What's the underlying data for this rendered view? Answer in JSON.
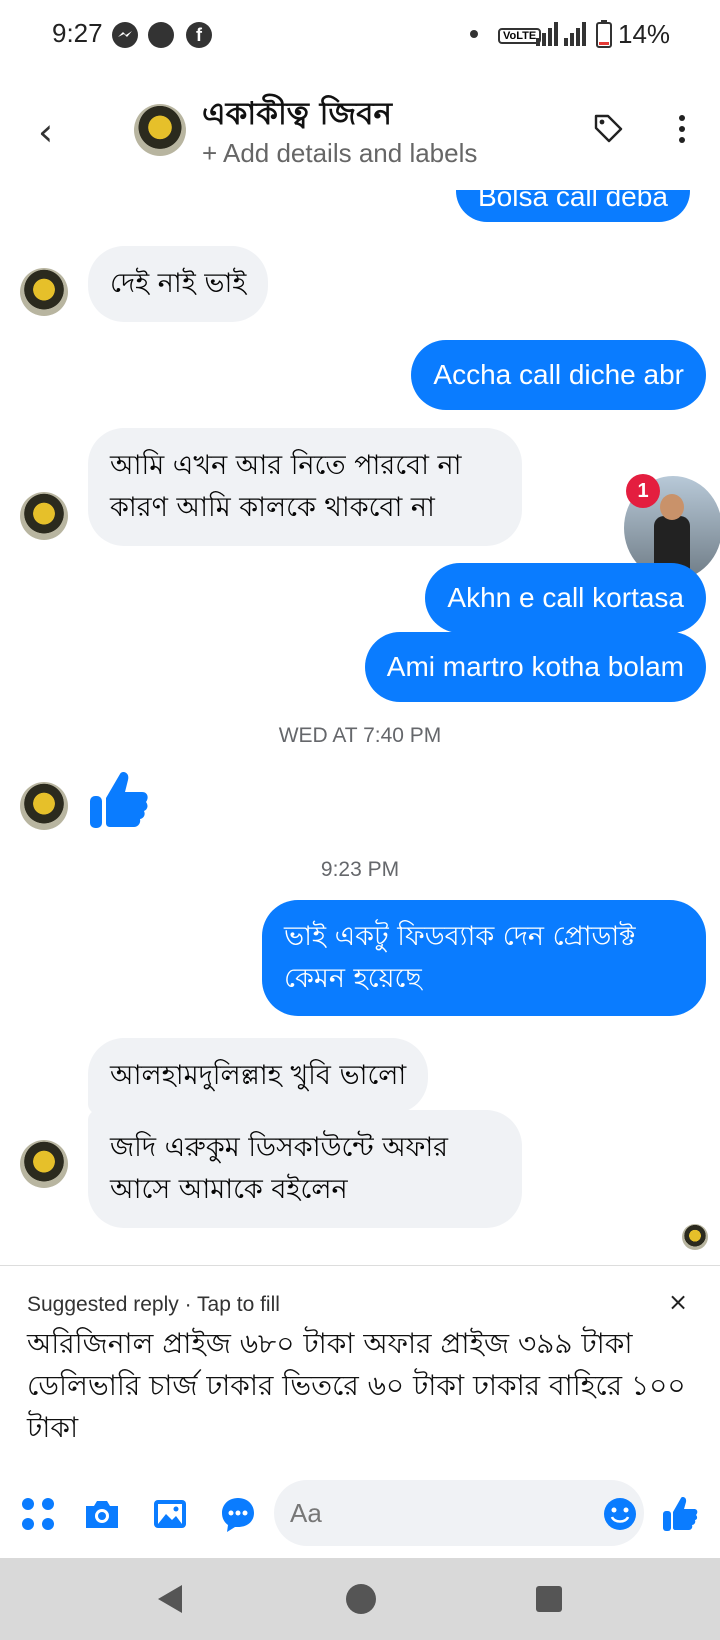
{
  "status_bar": {
    "time": "9:27",
    "icons": [
      "messenger-icon",
      "circle-icon",
      "facebook-icon"
    ],
    "network": "VoLTE",
    "battery": "14%"
  },
  "header": {
    "contact_name": "একাকীত্ব জিবন",
    "subtitle": "+ Add details and labels",
    "accent_color": "#0a7cff"
  },
  "messages": {
    "partial_top": "Bolsa call deba",
    "m1": "দেই নাই ভাই",
    "m2": "Accha call diche abr",
    "m3": "আমি এখন আর নিতে পারবো না কারণ আমি কালকে থাকবো না",
    "m4": "Akhn e call kortasa",
    "m5": "Ami martro kotha bolam",
    "ts1": "WED AT 7:40 PM",
    "ts2": "9:23 PM",
    "m6": "ভাই একটু ফিডব্যাক দেন প্রোডাক্ট কেমন হয়েছে",
    "m7": "আলহামদুলিল্লাহ খুবি ভালো",
    "m8": "জদি এরুকুম ডিসকাউন্টে অফার আসে আমাকে বইলেন"
  },
  "chat_head": {
    "badge": "1"
  },
  "suggested_reply": {
    "label": "Suggested reply · Tap to fill",
    "close": "×",
    "text": "অরিজিনাল প্রাইজ ৬৮০ টাকা অফার প্রাইজ ৩৯৯ টাকা ডেলিভারি চার্জ ঢাকার ভিতরে ৬০ টাকা ঢাকার বাহিরে ১০০ টাকা"
  },
  "composer": {
    "placeholder": "Aa"
  }
}
